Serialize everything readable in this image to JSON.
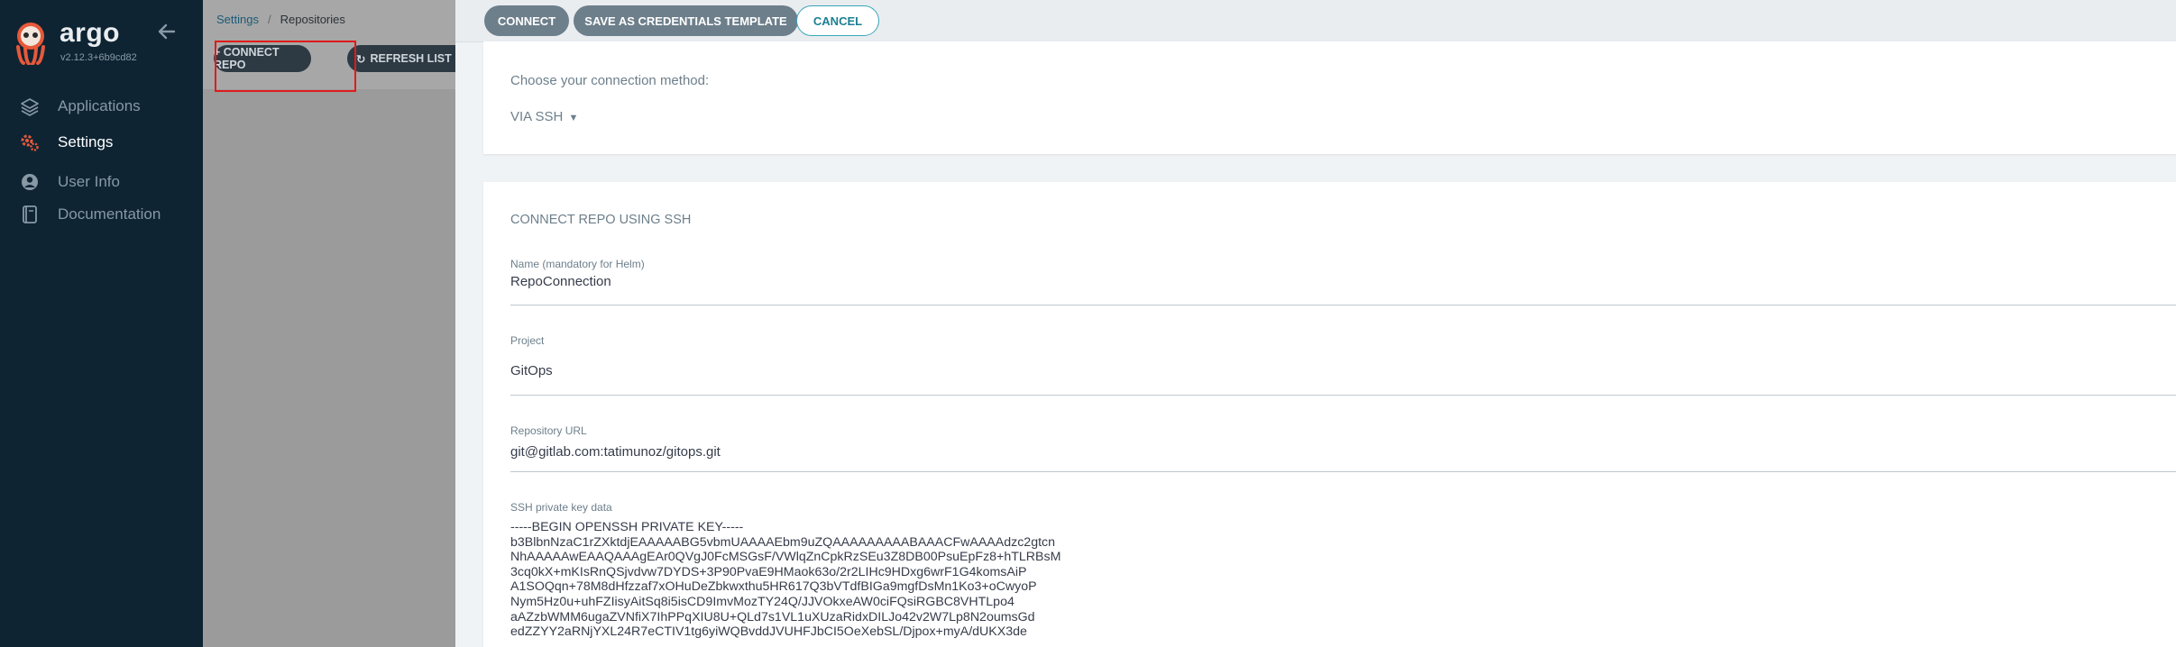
{
  "app": {
    "name": "argo",
    "version": "v2.12.3+6b9cd82"
  },
  "sidebar": {
    "items": [
      {
        "label": "Applications",
        "icon": "layers-icon",
        "active": false
      },
      {
        "label": "Settings",
        "icon": "gears-icon",
        "active": true
      },
      {
        "label": "User Info",
        "icon": "user-circle-icon",
        "active": false
      },
      {
        "label": "Documentation",
        "icon": "book-icon",
        "active": false
      }
    ]
  },
  "breadcrumb": {
    "parent": "Settings",
    "current": "Repositories"
  },
  "toolbar": {
    "connect_repo": "+ CONNECT REPO",
    "refresh_list": "REFRESH LIST"
  },
  "panel": {
    "buttons": {
      "connect": "CONNECT",
      "save_template": "SAVE AS CREDENTIALS TEMPLATE",
      "cancel": "CANCEL"
    },
    "method_prompt": "Choose your connection method:",
    "method_value": "VIA SSH",
    "section_title": "CONNECT REPO USING SSH",
    "fields": {
      "name": {
        "label": "Name (mandatory for Helm)",
        "value": "RepoConnection"
      },
      "project": {
        "label": "Project",
        "value": "GitOps"
      },
      "repo_url": {
        "label": "Repository URL",
        "value": "git@gitlab.com:tatimunoz/gitops.git"
      },
      "ssh_key": {
        "label": "SSH private key data"
      }
    },
    "ssh_key_lines": [
      "-----BEGIN OPENSSH PRIVATE KEY-----",
      "b3BlbnNzaC1rZXktdjEAAAAABG5vbmUAAAAEbm9uZQAAAAAAAAABAAACFwAAAAdzc2gtcn",
      "NhAAAAAwEAAQAAAgEAr0QVgJ0FcMSGsF/VWlqZnCpkRzSEu3Z8DB00PsuEpFz8+hTLRBsM",
      "3cq0kX+mKIsRnQSjvdvw7DYDS+3P90PvaE9HMaok63o/2r2LIHc9HDxg6wrF1G4komsAiP",
      "A1SOQqn+78M8dHfzzaf7xOHuDeZbkwxthu5HR617Q3bVTdfBIGa9mgfDsMn1Ko3+oCwyoP",
      "Nym5Hz0u+uhFZIisyAitSq8i5isCD9ImvMozTY24Q/JJVOkxeAW0ciFQsiRGBC8VHTLpo4",
      "aAZzbWMM6ugaZVNfiX7IhPPqXIU8U+QLd7s1VL1uXUzaRidxDILJo42v2W7Lp8N2oumsGd",
      "edZZYY2aRNjYXL24R7eCTIV1tg6yiWQBvddJVUHFJbCI5OeXebSL/Djpox+myA/dUKX3de"
    ]
  }
}
